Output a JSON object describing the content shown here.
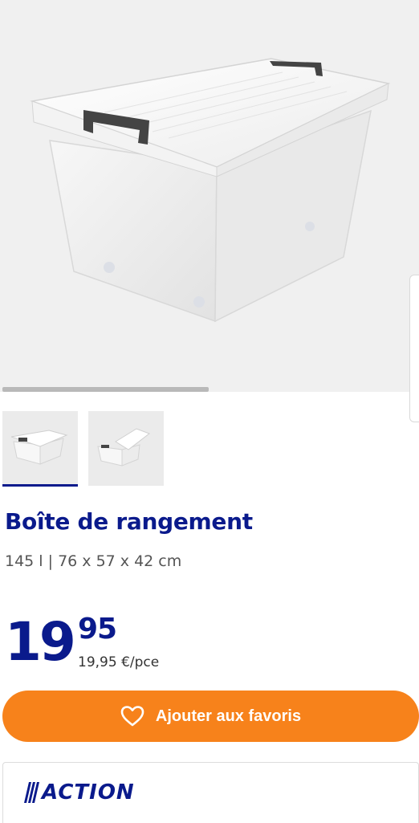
{
  "product": {
    "title": "Boîte de rangement",
    "specs": "145 l | 76 x 57 x 42 cm",
    "image": "clear-plastic-storage-box-with-lid",
    "thumbnails": [
      "storage-box-closed",
      "storage-box-open"
    ]
  },
  "price": {
    "integer": "19",
    "decimal": "95",
    "unit_price": "19,95 €/pce"
  },
  "actions": {
    "favorite_label": "Ajouter aux favoris",
    "favorite_icon": "heart-icon"
  },
  "seller": {
    "logo_text": "ACTION"
  },
  "colors": {
    "brand_blue": "#0a1a8c",
    "accent_orange": "#f7821b"
  }
}
